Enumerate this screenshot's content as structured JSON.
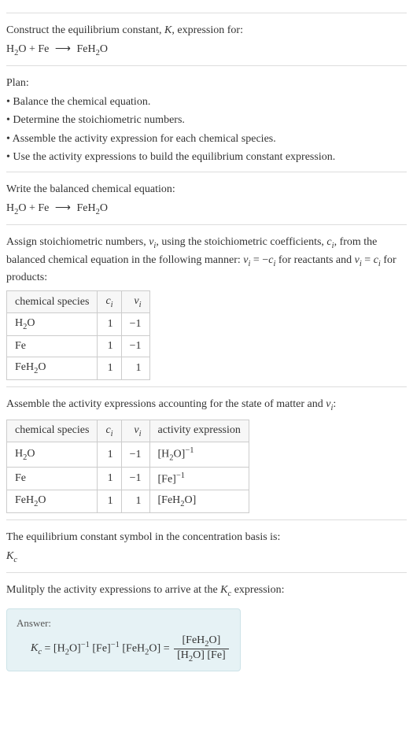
{
  "intro": {
    "line1": "Construct the equilibrium constant, K, expression for:",
    "reaction": "H₂O + Fe ⟶ FeH₂O"
  },
  "plan": {
    "title": "Plan:",
    "items": [
      "• Balance the chemical equation.",
      "• Determine the stoichiometric numbers.",
      "• Assemble the activity expression for each chemical species.",
      "• Use the activity expressions to build the equilibrium constant expression."
    ]
  },
  "balanced": {
    "title": "Write the balanced chemical equation:",
    "reaction": "H₂O + Fe ⟶ FeH₂O"
  },
  "assign": {
    "text1": "Assign stoichiometric numbers, νᵢ, using the stoichiometric coefficients, cᵢ, from the balanced chemical equation in the following manner: νᵢ = −cᵢ for reactants and νᵢ = cᵢ for products:",
    "headers": {
      "h1": "chemical species",
      "h2": "cᵢ",
      "h3": "νᵢ"
    },
    "rows": [
      {
        "species": "H₂O",
        "c": "1",
        "v": "−1"
      },
      {
        "species": "Fe",
        "c": "1",
        "v": "−1"
      },
      {
        "species": "FeH₂O",
        "c": "1",
        "v": "1"
      }
    ]
  },
  "activity": {
    "title": "Assemble the activity expressions accounting for the state of matter and νᵢ:",
    "headers": {
      "h1": "chemical species",
      "h2": "cᵢ",
      "h3": "νᵢ",
      "h4": "activity expression"
    },
    "rows": [
      {
        "species": "H₂O",
        "c": "1",
        "v": "−1",
        "act_base": "[H₂O]",
        "act_exp": "−1"
      },
      {
        "species": "Fe",
        "c": "1",
        "v": "−1",
        "act_base": "[Fe]",
        "act_exp": "−1"
      },
      {
        "species": "FeH₂O",
        "c": "1",
        "v": "1",
        "act_base": "[FeH₂O]",
        "act_exp": ""
      }
    ]
  },
  "symbol": {
    "text": "The equilibrium constant symbol in the concentration basis is:",
    "value": "K꜀"
  },
  "multiply": {
    "text": "Mulitply the activity expressions to arrive at the K꜀ expression:"
  },
  "answer": {
    "label": "Answer:",
    "lhs": "K꜀ = ",
    "term1_base": "[H₂O]",
    "term1_exp": "−1",
    "term2_base": "[Fe]",
    "term2_exp": "−1",
    "term3": "[FeH₂O]",
    "eq": " = ",
    "frac_top": "[FeH₂O]",
    "frac_bot": "[H₂O] [Fe]"
  }
}
